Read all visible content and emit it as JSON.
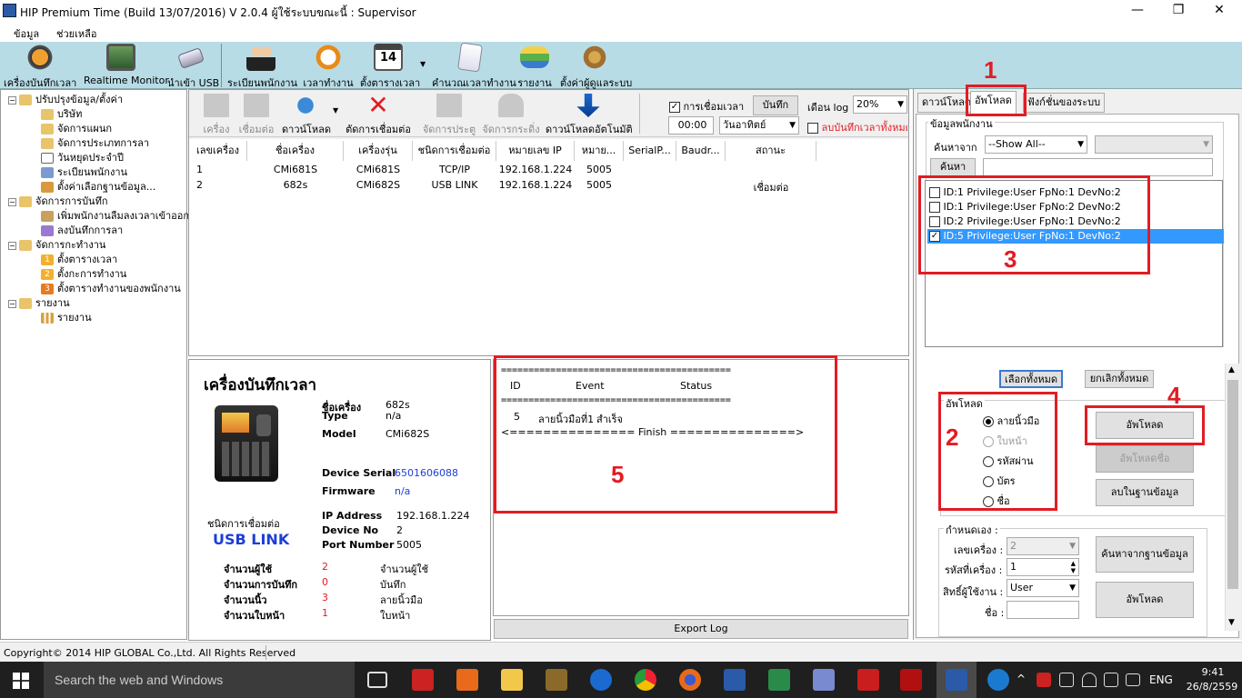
{
  "window": {
    "title": "HIP Premium Time (Build 13/07/2016) V 2.0.4   ผู้ใช้ระบบขณะนี้ : Supervisor",
    "minimize": "—",
    "restore": "❐",
    "close": "✕"
  },
  "menu": [
    "ข้อมูล",
    "ช่วยเหลือ"
  ],
  "ribbon": [
    "เครื่องบันทึกเวลา",
    "Realtime Monitor",
    "นำเข้า USB",
    "ระเบียนพนักงาน",
    "เวลาทำงาน",
    "ตั้งตารางเวลา",
    "คำนวณเวลาทำงาน",
    "รายงาน",
    "ตั้งค่าผู้ดูแลระบบ"
  ],
  "ribbon_calendar_day": "14",
  "tree": {
    "groups": [
      {
        "label": "ปรับปรุงข้อมูล/ตั้งค่า",
        "items": [
          "บริษัท",
          "จัดการแผนก",
          "จัดการประเภทการลา",
          "วันหยุดประจำปี",
          "ระเบียนพนักงาน",
          "ตั้งค่าเลือกฐานข้อมูล..."
        ]
      },
      {
        "label": "จัดการการบันทึก",
        "items": [
          "เพิ่มพนักงานลืมลงเวลาเข้าออก",
          "ลงบันทึกการลา"
        ]
      },
      {
        "label": "จัดการกะทำงาน",
        "items": [
          "ตั้งตารางเวลา",
          "ตั้งกะการทำงาน",
          "ตั้งตารางทำงานของพนักงาน"
        ]
      },
      {
        "label": "รายงาน",
        "items": [
          "รายงาน"
        ]
      }
    ],
    "badges": [
      "1",
      "2",
      "3"
    ]
  },
  "toolbar": {
    "buttons": [
      "เครื่อง",
      "เชื่อมต่อ",
      "ดาวน์โหลด",
      "ตัดการเชื่อมต่อ",
      "จัดการประตู",
      "จัดการกระดิ่ง",
      "ดาวน์โหลดอัตโนมัติ"
    ],
    "connect_time_label": "การเชื่อมเวลา",
    "save_label": "บันทึก",
    "log_month_label": "เดือน log",
    "log_percent": "20%",
    "time_value": "00:00",
    "weekday": "วันอาทิตย์",
    "delete_all_label": "ลบบันทึกเวลาทั้งหมด"
  },
  "grid": {
    "headers": [
      "เลขเครื่อง",
      "ชื่อเครื่อง",
      "เครื่องรุ่น",
      "ชนิดการเชื่อมต่อ",
      "หมายเลข IP",
      "หมาย...",
      "SerialP...",
      "Baudr...",
      "สถานะ"
    ],
    "rows": [
      [
        "1",
        "CMi681S",
        "CMi681S",
        "TCP/IP",
        "192.168.1.224",
        "5005",
        "",
        "",
        ""
      ],
      [
        "2",
        "682s",
        "CMi682S",
        "USB LINK",
        "192.168.1.224",
        "5005",
        "",
        "",
        "เชื่อมต่อ"
      ]
    ]
  },
  "device": {
    "heading": "เครื่องบันทึกเวลา",
    "name_label": "ชื่อเครื่อง",
    "name": "682s",
    "type_label": "Type",
    "type": "n/a",
    "model_label": "Model",
    "model": "CMi682S",
    "serial_label": "Device Serial",
    "serial": "6501606088",
    "firmware_label": "Firmware",
    "firmware": "n/a",
    "conn_label": "ชนิดการเชื่อมต่อ",
    "conn": "USB LINK",
    "ip_label": "IP Address",
    "ip": "192.168.1.224",
    "devno_label": "Device No",
    "devno": "2",
    "port_label": "Port Number",
    "port": "5005",
    "stats": [
      {
        "label": "จำนวนผู้ใช้",
        "value": "2",
        "unit": "จำนวนผู้ใช้",
        "color": "#e21c23"
      },
      {
        "label": "จำนวนการบันทึก",
        "value": "0",
        "unit": "บันทึก",
        "color": "#e21c23"
      },
      {
        "label": "จำนวนนิ้ว",
        "value": "3",
        "unit": "ลายนิ้วมือ",
        "color": "#e21c23"
      },
      {
        "label": "จำนวนใบหน้า",
        "value": "1",
        "unit": "ใบหน้า",
        "color": "#e21c23"
      }
    ]
  },
  "log": {
    "sep1": "==========================================",
    "col_id": "ID",
    "col_event": "Event",
    "col_status": "Status",
    "sep2": "==========================================",
    "row_id": "5",
    "row_event": "ลายนิ้วมือที่1",
    "row_status": "สำเร็จ",
    "finish": "<=============== Finish ===============>",
    "export_label": "Export Log"
  },
  "right": {
    "tabs": [
      "ดาวน์โหลด",
      "อัพโหลด",
      "ฟังก์ชั่นของระบบ"
    ],
    "group_label": "ข้อมูลพนักงาน",
    "search_from_label": "ค้นหาจาก",
    "search_from_value": "--Show All--",
    "search_button": "ค้นหา",
    "users": [
      {
        "text": "ID:1 Privilege:User FpNo:1 DevNo:2",
        "checked": false,
        "selected": false
      },
      {
        "text": "ID:1 Privilege:User FpNo:2 DevNo:2",
        "checked": false,
        "selected": false
      },
      {
        "text": "ID:2 Privilege:User FpNo:1 DevNo:2",
        "checked": false,
        "selected": false
      },
      {
        "text": "ID:5 Privilege:User FpNo:1 DevNo:2",
        "checked": true,
        "selected": true
      }
    ],
    "select_all": "เลือกทั้งหมด",
    "deselect_all": "ยกเลิกทั้งหมด",
    "upload_group": "อัพโหลด",
    "options": [
      {
        "label": "ลายนิ้วมือ",
        "checked": true,
        "disabled": false
      },
      {
        "label": "ใบหน้า",
        "checked": false,
        "disabled": true
      },
      {
        "label": "รหัสผ่าน",
        "checked": false,
        "disabled": false
      },
      {
        "label": "บัตร",
        "checked": false,
        "disabled": false
      },
      {
        "label": "ชื่อ",
        "checked": false,
        "disabled": false
      }
    ],
    "upload_button": "อัพโหลด",
    "upload_name_button": "อัพโหลดชื่อ",
    "delete_db_button": "ลบในฐานข้อมูล",
    "custom_group": "กำหนดเอง :",
    "machine_no_label": "เลขเครื่อง :",
    "machine_no": "2",
    "machine_code_label": "รหัสที่เครื่อง :",
    "machine_code": "1",
    "privilege_label": "สิทธิ์ผู้ใช้งาน :",
    "privilege": "User",
    "name_label": "ชื่อ :",
    "name_value": "",
    "find_db_button": "ค้นหาจากฐานข้อมูล",
    "upload_button2": "อัพโหลด"
  },
  "annotations": [
    "1",
    "2",
    "3",
    "4",
    "5"
  ],
  "status": {
    "copyright": "Copyright© 2014 HIP GLOBAL Co.,Ltd. All Rights Reserved"
  },
  "taskbar": {
    "search": "Search the web and Windows",
    "lang": "ENG",
    "time": "9:41",
    "date": "26/8/2559"
  },
  "colors": {
    "accent": "#e21c23",
    "selection": "#3399ff",
    "ribbon": "#b8dce6",
    "link_blue": "#1c3fd6"
  }
}
